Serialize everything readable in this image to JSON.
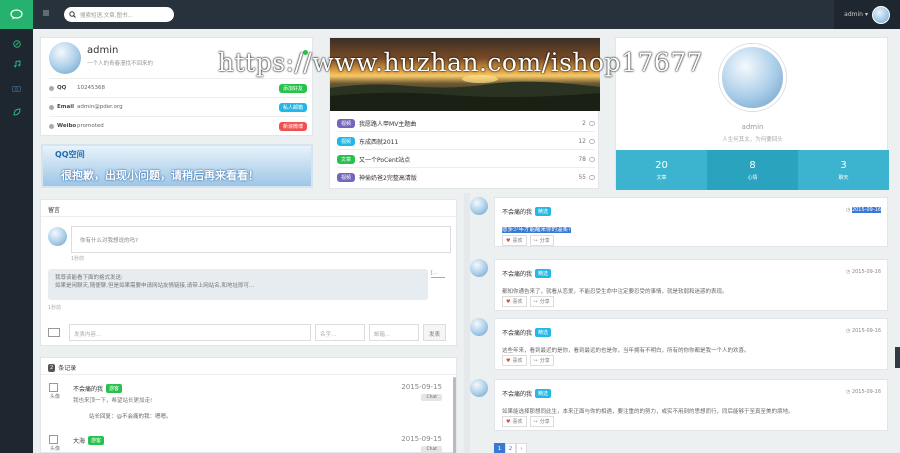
{
  "sidebar": {
    "icons": [
      "chat-icon",
      "compass-icon",
      "music-icon",
      "camera-icon",
      "leaf-icon"
    ]
  },
  "topbar": {
    "search_placeholder": "搜索短语,文章,图书...",
    "user": "admin"
  },
  "watermark": "https://www.huzhan.com/ishop17677",
  "profile": {
    "name": "admin",
    "subtitle": "一个人的青春漫找不回来的",
    "rows": [
      {
        "key": "QQ",
        "value": "10245368",
        "tag": "添加好友",
        "color": "#27c24c"
      },
      {
        "key": "Email",
        "value": "admin@pder.org",
        "tag": "私人邮箱",
        "color": "#23b7e5"
      },
      {
        "key": "Weibo",
        "value": "promoted",
        "tag": "新浪微博",
        "color": "#f05050"
      }
    ]
  },
  "banner": {
    "logo": "QQ空间",
    "message": "很抱歉，出现小问题，请稍后再来看看！"
  },
  "news": {
    "items": [
      {
        "tag": "视频",
        "tag_color": "#7266ba",
        "title": "我愿路人甲MV主题曲",
        "count": "2"
      },
      {
        "tag": "视频",
        "tag_color": "#23b7e5",
        "title": "东成西就2011",
        "count": "12"
      },
      {
        "tag": "文章",
        "tag_color": "#27c24c",
        "title": "又一个PoCent站点",
        "count": "78"
      },
      {
        "tag": "视频",
        "tag_color": "#7266ba",
        "title": "神偷奶爸2完整高清版",
        "count": "55"
      }
    ]
  },
  "user_card": {
    "name": "admin",
    "subtitle": "人生何其太，为何要回头",
    "stats": [
      {
        "num": "20",
        "label": "文章"
      },
      {
        "num": "8",
        "label": "心情"
      },
      {
        "num": "3",
        "label": "聊天"
      }
    ]
  },
  "guestbook": {
    "title": "留言",
    "input_placeholder": "你有什么对我想说的吗?",
    "time1": "1秒前",
    "notice_line1": "我尊该能看下面的格式发送:",
    "notice_line2": "如果是闲聊天,随便聊,但是如果需要申请网站友情链接,请带上网站名,和地址即可...",
    "img_alt": "[...",
    "time2": "1秒前",
    "form": {
      "content": "发表内容...",
      "name": "名字...",
      "email": "邮箱...",
      "submit": "发表"
    }
  },
  "records": {
    "count": "2",
    "title": "条记录",
    "items": [
      {
        "avatar_text": "头像",
        "name": "不会痛的我",
        "tag": "游客",
        "date": "2015-09-15",
        "chip": "Chat",
        "text": "我也来顶一下，希望站长更加走!",
        "reply": "站长回复：@不会痛的我：嗯嗯。"
      },
      {
        "avatar_text": "头像",
        "name": "大海",
        "tag": "游客",
        "date": "2015-09-15",
        "chip": "Chat",
        "text": "",
        "reply": ""
      }
    ]
  },
  "timeline": [
    {
      "name": "不会痛的我",
      "tag": "精选",
      "date": "2015-09-16",
      "text": "愿多少年才能醒来你的温柔?",
      "like": "喜欢",
      "share": "分享",
      "selected": true
    },
    {
      "name": "不会痛的我",
      "tag": "精选",
      "date": "2015-09-16",
      "text": "都知你通告来了，就看从恋爱，不能忍受生命中注定要忍受的事情，就是软弱和迷惑的表现。",
      "like": "喜欢",
      "share": "分享",
      "selected": false
    },
    {
      "name": "不会痛的我",
      "tag": "精选",
      "date": "2015-09-16",
      "text": "这些年来，看到最近的是你，看到最远的也是你，当年拥有不明白，所有的你你都是我一个人的欢喜。",
      "like": "喜欢",
      "share": "分享",
      "selected": false
    },
    {
      "name": "不会痛的我",
      "tag": "精选",
      "date": "2015-09-16",
      "text": "如果能选择那想同此生，本来正面与你的相遇，要注重的的努力，或实不用刻的思想而行，同后能够于至真至美的境地。",
      "like": "喜欢",
      "share": "分享",
      "selected": false
    }
  ],
  "pager": [
    "1",
    "2",
    "›"
  ]
}
